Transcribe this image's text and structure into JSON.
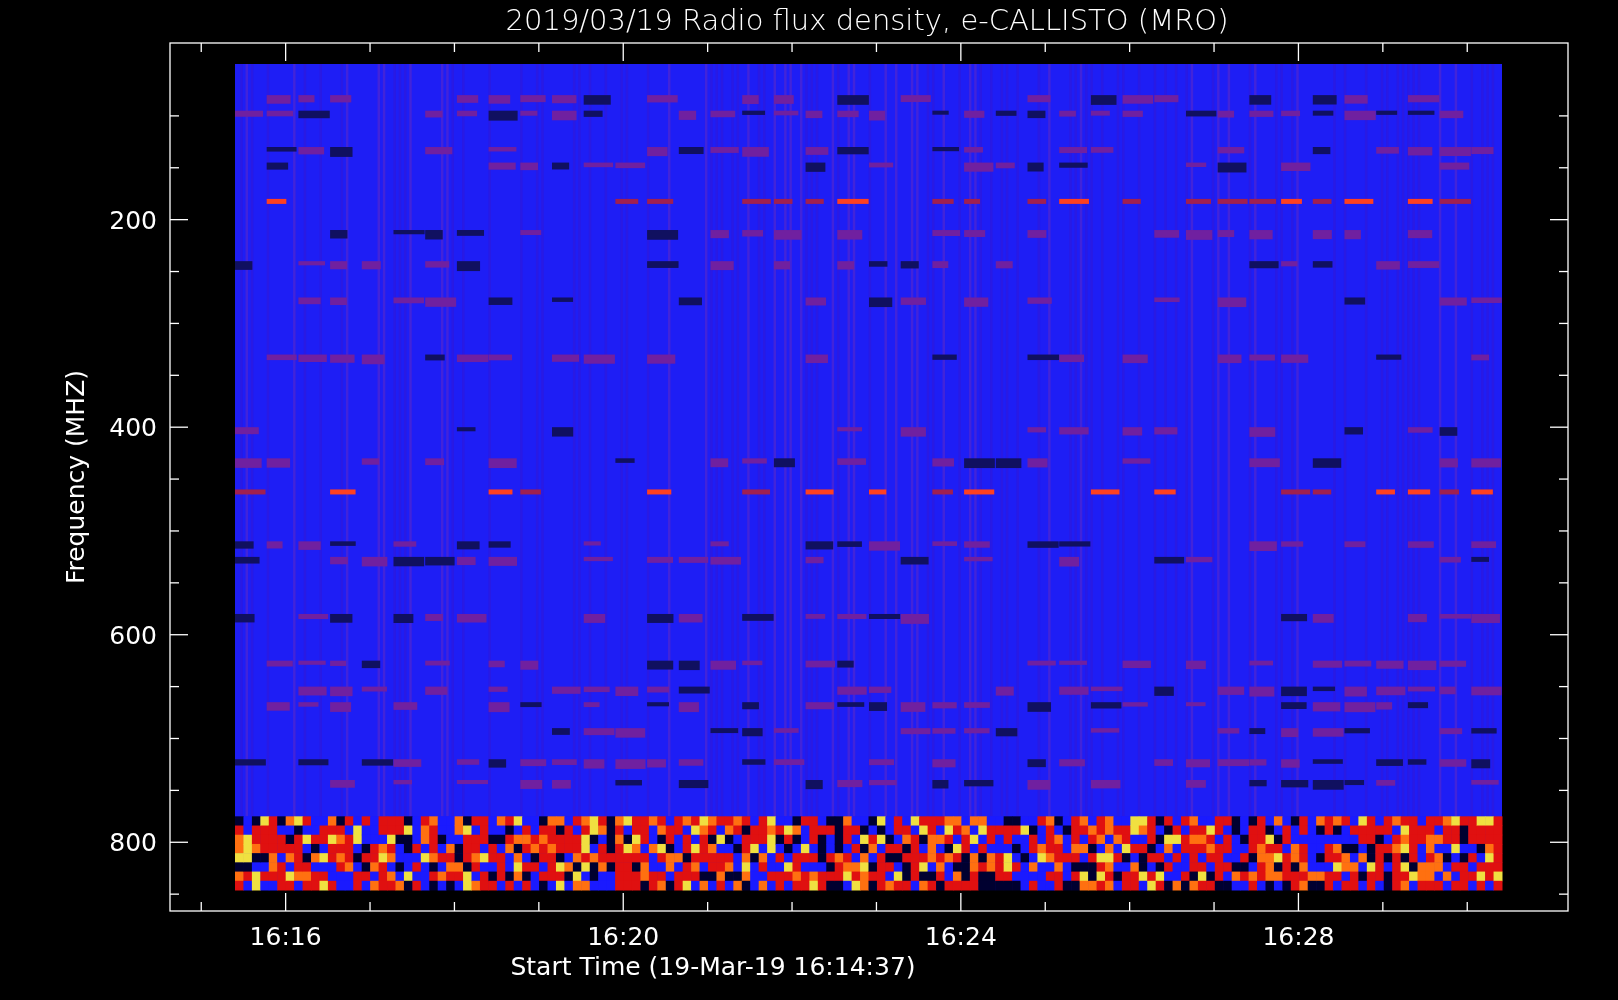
{
  "title": "2019/03/19  Radio flux density, e-CALLISTO (MRO)",
  "ylabel": "Frequency (MHZ)",
  "xlabel": "Start Time (19-Mar-19 16:14:37)",
  "yticks": [
    "200",
    "400",
    "600",
    "800"
  ],
  "xticks": [
    "16:16",
    "16:20",
    "16:24",
    "16:28"
  ]
}
